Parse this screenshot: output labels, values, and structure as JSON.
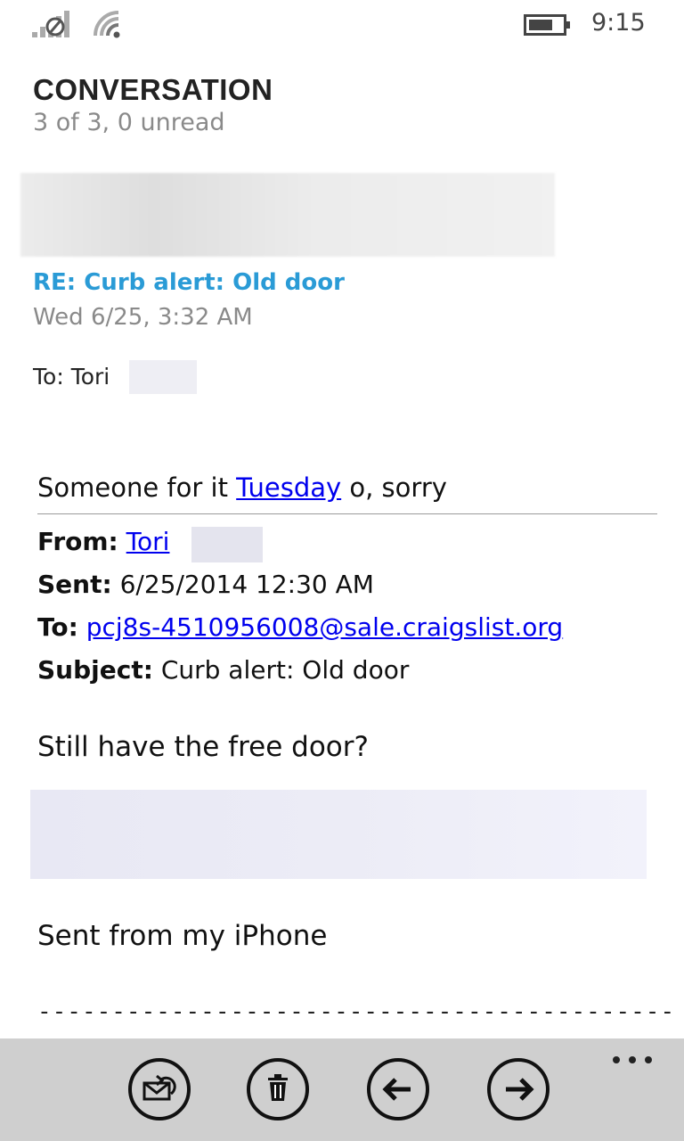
{
  "status_bar": {
    "time": "9:15",
    "icons": [
      "signal-no-sim-icon",
      "wifi-icon",
      "battery-icon"
    ]
  },
  "header": {
    "title": "CONVERSATION",
    "subtitle": "3 of 3, 0 unread"
  },
  "message": {
    "subject": "RE: Curb alert:  Old door",
    "date": "Wed 6/25, 3:32 AM",
    "to_label": "To: Tori",
    "body_prefix": "Someone for it ",
    "body_link": "Tuesday",
    "body_suffix": " o, sorry",
    "quoted": {
      "from_label": "From:",
      "from_value": "Tori",
      "sent_label": "Sent:",
      "sent_value": "6/25/2014 12:30 AM",
      "to_label": "To:",
      "to_value": "pcj8s-4510956008@sale.craigslist.org",
      "subject_label": "Subject:",
      "subject_value": "Curb alert:  Old door"
    },
    "question": "Still have the free door?",
    "signature": "Sent from my iPhone",
    "separator": "-------------------------------------------"
  },
  "app_bar": {
    "buttons": [
      "reply-icon",
      "delete-icon",
      "previous-icon",
      "next-icon"
    ],
    "more": "more-icon"
  },
  "colors": {
    "accent": "#2a9bd6",
    "link": "#0000ee",
    "app_bar_bg": "#cfcfcf",
    "secondary_text": "#8a8a8a"
  }
}
